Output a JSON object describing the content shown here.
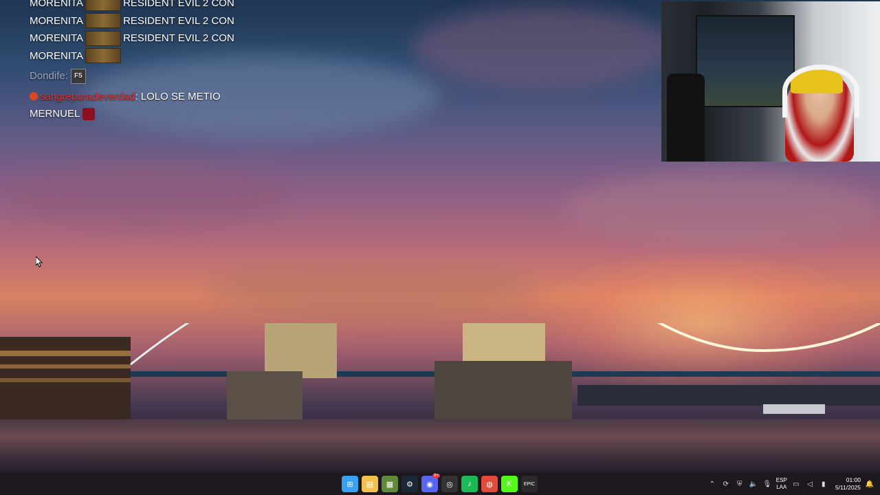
{
  "chat": {
    "messages": [
      {
        "user": "MORENITA",
        "text": "RESIDENT EVIL 2 CON"
      },
      {
        "user": "MORENITA",
        "text": "RESIDENT EVIL 2 CON"
      },
      {
        "user": "MORENITA",
        "text": "RESIDENT EVIL 2 CON"
      },
      {
        "user": "MORENITA",
        "text": ""
      }
    ],
    "dondife": {
      "user": "Dondife:",
      "emote_text": "F5"
    },
    "sangre": {
      "user": "sangrepuradeverdad",
      "text": ": LOLO SE METIO"
    },
    "mernuel": {
      "text": "MERNUEL"
    }
  },
  "taskbar": {
    "apps": [
      {
        "name": "windows-start",
        "color": "#3aa0f0",
        "glyph": "⊞"
      },
      {
        "name": "file-explorer",
        "color": "#f2c14e",
        "glyph": "▤"
      },
      {
        "name": "minecraft",
        "color": "#5f8a3a",
        "glyph": "▦"
      },
      {
        "name": "steam",
        "color": "#1b2838",
        "glyph": "⚙"
      },
      {
        "name": "discord",
        "color": "#5865f2",
        "glyph": "◉",
        "badge": "9+"
      },
      {
        "name": "obs",
        "color": "#333333",
        "glyph": "◎"
      },
      {
        "name": "spotify",
        "color": "#1db954",
        "glyph": "♪"
      },
      {
        "name": "chrome",
        "color": "#e24a3a",
        "glyph": "◍"
      },
      {
        "name": "kick",
        "color": "#53fc18",
        "glyph": "K"
      },
      {
        "name": "epic-games",
        "color": "#2a2a2a",
        "glyph": "EPIC"
      }
    ],
    "lang_top": "ESP",
    "lang_bottom": "LAA",
    "time": "01:00",
    "date": "5/11/2025"
  }
}
